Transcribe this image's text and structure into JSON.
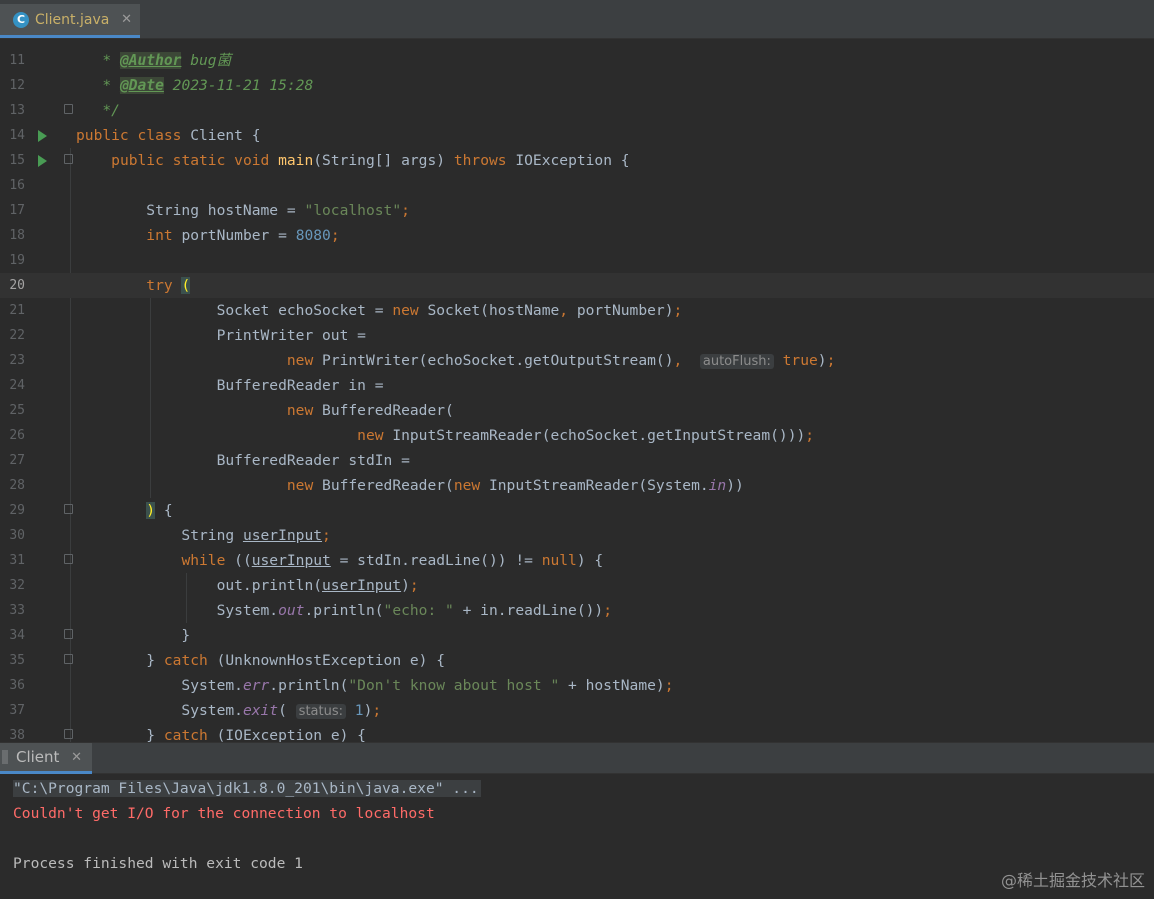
{
  "tab": {
    "filename": "Client.java",
    "icon": "java-class-icon"
  },
  "editor": {
    "lines": [
      {
        "n": "11",
        "html": "   <span class=\"cm\">* </span><span class=\"tag\">@Author</span><span class=\"cm\"> bug菌</span>"
      },
      {
        "n": "12",
        "html": "   <span class=\"cm\">* </span><span class=\"tag\">@Date</span><span class=\"cm\"> 2023-11-21 15:28</span>"
      },
      {
        "n": "13",
        "html": "   <span class=\"cm\">*/</span>"
      },
      {
        "n": "14",
        "html": "<span class=\"kw\">public class </span>Client {"
      },
      {
        "n": "15",
        "html": "    <span class=\"kw\">public static void </span><span class=\"fn\">main</span>(String[] args) <span class=\"kw\">throws </span>IOException {"
      },
      {
        "n": "16",
        "html": ""
      },
      {
        "n": "17",
        "html": "        String hostName = <span class=\"str\">\"localhost\"</span><span class=\"kw\">;</span>"
      },
      {
        "n": "18",
        "html": "        <span class=\"kw\">int </span>portNumber = <span class=\"num\">8080</span><span class=\"kw\">;</span>"
      },
      {
        "n": "19",
        "html": ""
      },
      {
        "n": "20",
        "html": "        <span class=\"kw\">try </span><span class=\"brace-hl\">(</span>"
      },
      {
        "n": "21",
        "html": "                Socket echoSocket = <span class=\"kw\">new </span>Socket(hostName<span class=\"kw\">, </span>portNumber)<span class=\"kw\">;</span>"
      },
      {
        "n": "22",
        "html": "                PrintWriter out ="
      },
      {
        "n": "23",
        "html": "                        <span class=\"kw\">new </span>PrintWriter(echoSocket.getOutputStream()<span class=\"kw\">, </span> <span class=\"hint\">autoFlush:</span> <span class=\"kw\">true</span>)<span class=\"kw\">;</span>"
      },
      {
        "n": "24",
        "html": "                BufferedReader in ="
      },
      {
        "n": "25",
        "html": "                        <span class=\"kw\">new </span>BufferedReader("
      },
      {
        "n": "26",
        "html": "                                <span class=\"kw\">new </span>InputStreamReader(echoSocket.getInputStream()))<span class=\"kw\">;</span>"
      },
      {
        "n": "27",
        "html": "                BufferedReader stdIn ="
      },
      {
        "n": "28",
        "html": "                        <span class=\"kw\">new </span>BufferedReader(<span class=\"kw\">new </span>InputStreamReader(System.<span class=\"ital\">in</span>))"
      },
      {
        "n": "29",
        "html": "        <span class=\"brace-hl\">)</span> {"
      },
      {
        "n": "30",
        "html": "            String <span class=\"und\">userInput</span><span class=\"kw\">;</span>"
      },
      {
        "n": "31",
        "html": "            <span class=\"kw\">while </span>((<span class=\"und\">userInput</span> = stdIn.readLine()) != <span class=\"kw\">null</span>) {"
      },
      {
        "n": "32",
        "html": "                out.println(<span class=\"und\">userInput</span>)<span class=\"kw\">;</span>"
      },
      {
        "n": "33",
        "html": "                System.<span class=\"ital\">out</span>.println(<span class=\"str\">\"echo: \"</span> + in.readLine())<span class=\"kw\">;</span>"
      },
      {
        "n": "34",
        "html": "            }"
      },
      {
        "n": "35",
        "html": "        } <span class=\"kw\">catch </span>(UnknownHostException e) {"
      },
      {
        "n": "36",
        "html": "            System.<span class=\"ital\">err</span>.println(<span class=\"str\">\"Don't know about host \"</span> + hostName)<span class=\"kw\">;</span>"
      },
      {
        "n": "37",
        "html": "            System.<span class=\"ital\">exit</span>( <span class=\"hint\">status:</span> <span class=\"num\">1</span>)<span class=\"kw\">;</span>"
      },
      {
        "n": "38",
        "html": "        } <span class=\"kw\">catch </span>(IOException e) {"
      }
    ]
  },
  "run": {
    "tab_label": "Client",
    "console": {
      "command": "\"C:\\Program Files\\Java\\jdk1.8.0_201\\bin\\java.exe\" ...",
      "error": "Couldn't get I/O for the connection to localhost",
      "blank": "",
      "finished": "Process finished with exit code 1"
    }
  },
  "watermark": "@稀土掘金技术社区",
  "colors": {
    "keyword": "#cc7832",
    "string": "#6a8759",
    "number": "#6897bb",
    "error": "#ff6b68",
    "accent": "#4a88c7"
  }
}
